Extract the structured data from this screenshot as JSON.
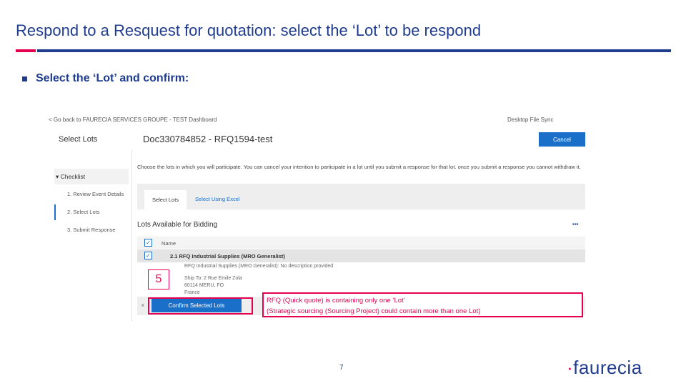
{
  "slide": {
    "title": "Respond to a Resquest for quotation: select the ‘Lot’ to be respond",
    "bullet": "Select the ‘Lot’ and confirm:",
    "page_number": "7",
    "logo_dot": "·",
    "logo_text": "faurecia"
  },
  "colors": {
    "brand_blue": "#1f3c8f",
    "accent_red": "#e5004f",
    "button_blue": "#1a6fc9"
  },
  "screenshot": {
    "back_link": "< Go back to FAURECIA SERVICES GROUPE - TEST Dashboard",
    "desktop_sync": "Desktop File Sync",
    "select_lots_heading": "Select Lots",
    "doc_title": "Doc330784852 - RFQ1594-test",
    "cancel_label": "Cancel",
    "checklist_label": "Checklist",
    "checklist_toggle_icon": "▾",
    "checklist_items": [
      "1.  Review Event Details",
      "2.  Select Lots",
      "3.  Submit Response"
    ],
    "instructions": "Choose the lots in which you will participate. You can cancel your intention to participate in a lot until you submit a response for that lot. once you submit a response you cannot withdraw it.",
    "tabs": [
      "Select Lots",
      "Select Using Excel"
    ],
    "lots_heading": "Lots Available for Bidding",
    "grid_icon": "▪▪▪",
    "column_name": "Name",
    "check_glyph": "✓",
    "lot_name": "2.1   RFQ Industrial Supplies (MRO Generalist)",
    "lot_description": "RFQ Industrial Supplies (MRO Generalist): No description provided",
    "ship_to_lines": [
      "Ship To: 2 Rue Emile Zola",
      "60114 MERU, FO",
      "France"
    ],
    "confirm_row_marker": "x",
    "confirm_label": "Confirm Selected Lots"
  },
  "annotations": {
    "step_number": "5",
    "note_lines": [
      "RFQ (Quick quote) is containing only one ‘Lot’",
      "(Strategic sourcing (Sourcing Project) could contain more than one Lot)"
    ]
  }
}
